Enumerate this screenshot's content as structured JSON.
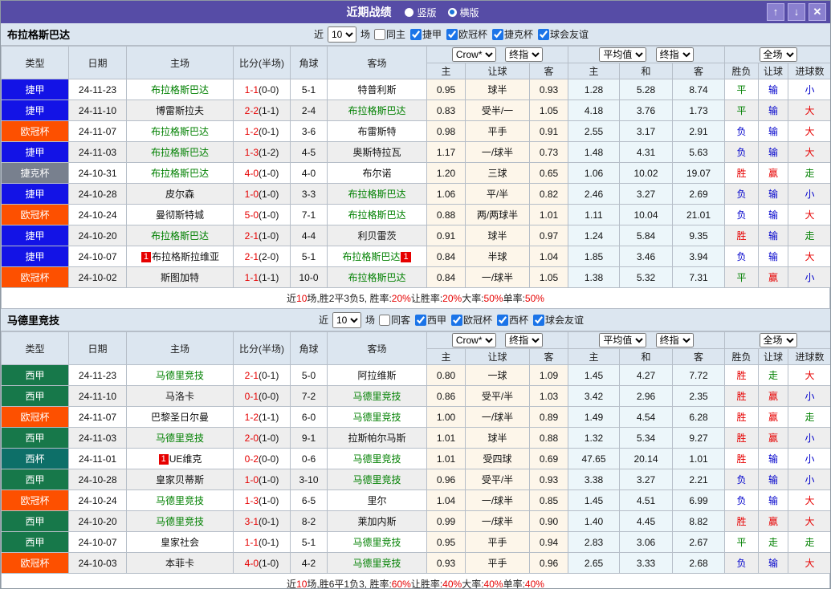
{
  "titlebar": {
    "title": "近期战绩",
    "radio_vertical": "竖版",
    "radio_horizontal": "横版"
  },
  "icons": {
    "up": "↑",
    "down": "↓",
    "close": "✕"
  },
  "headers": {
    "type": "类型",
    "date": "日期",
    "home": "主场",
    "score": "比分(半场)",
    "corner": "角球",
    "away": "客场",
    "sub_home": "主",
    "sub_handicap": "让球",
    "sub_away": "客",
    "sub_avg_home": "主",
    "sub_avg_draw": "和",
    "sub_avg_away": "客",
    "sub_wdl": "胜负",
    "sub_hcp": "让球",
    "sub_goals": "进球数"
  },
  "selects": {
    "source": "Crow*",
    "final": "终指",
    "average": "平均值",
    "fulltime": "全场"
  },
  "colors": {
    "league": {
      "捷甲": "#1313e6",
      "欧冠杯": "#fd5000",
      "捷克杯": "#78808e",
      "西甲": "#17784a",
      "西杯": "#0d6f68"
    },
    "result": {
      "胜": "#e60000",
      "平": "#008000",
      "负": "#0000cc",
      "赢": "#e60000",
      "输": "#0000cc",
      "走": "#008000",
      "大": "#e60000",
      "小": "#0000cc"
    },
    "accent_purple": "#564ca6",
    "team_green": "#008000",
    "score_red": "#e60000"
  },
  "sections": [
    {
      "team": "布拉格斯巴达",
      "filter": {
        "near": "近",
        "count": "10",
        "games": "场",
        "same": "同主",
        "same_checked": false,
        "leagues": [
          "捷甲",
          "欧冠杯",
          "捷克杯",
          "球会友谊"
        ],
        "leagues_checked": [
          true,
          true,
          true,
          true
        ]
      },
      "rows": [
        {
          "league": "捷甲",
          "date": "24-11-23",
          "home": {
            "name": "布拉格斯巴达",
            "self": true,
            "badge": null
          },
          "score": "1-1",
          "half": "(0-0)",
          "corners": "5-1",
          "away": {
            "name": "特普利斯",
            "self": false,
            "badge": null
          },
          "odds": [
            "0.95",
            "球半",
            "0.93"
          ],
          "avg": [
            "1.28",
            "5.28",
            "8.74"
          ],
          "results": [
            "平",
            "输",
            "小"
          ]
        },
        {
          "league": "捷甲",
          "date": "24-11-10",
          "home": {
            "name": "博雷斯拉夫",
            "self": false,
            "badge": null
          },
          "score": "2-2",
          "half": "(1-1)",
          "corners": "2-4",
          "away": {
            "name": "布拉格斯巴达",
            "self": true,
            "badge": null
          },
          "odds": [
            "0.83",
            "受半/一",
            "1.05"
          ],
          "avg": [
            "4.18",
            "3.76",
            "1.73"
          ],
          "results": [
            "平",
            "输",
            "大"
          ]
        },
        {
          "league": "欧冠杯",
          "date": "24-11-07",
          "home": {
            "name": "布拉格斯巴达",
            "self": true,
            "badge": null
          },
          "score": "1-2",
          "half": "(0-1)",
          "corners": "3-6",
          "away": {
            "name": "布雷斯特",
            "self": false,
            "badge": null
          },
          "odds": [
            "0.98",
            "平手",
            "0.91"
          ],
          "avg": [
            "2.55",
            "3.17",
            "2.91"
          ],
          "results": [
            "负",
            "输",
            "大"
          ]
        },
        {
          "league": "捷甲",
          "date": "24-11-03",
          "home": {
            "name": "布拉格斯巴达",
            "self": true,
            "badge": null
          },
          "score": "1-3",
          "half": "(1-2)",
          "corners": "4-5",
          "away": {
            "name": "奥斯特拉瓦",
            "self": false,
            "badge": null
          },
          "odds": [
            "1.17",
            "一/球半",
            "0.73"
          ],
          "avg": [
            "1.48",
            "4.31",
            "5.63"
          ],
          "results": [
            "负",
            "输",
            "大"
          ]
        },
        {
          "league": "捷克杯",
          "date": "24-10-31",
          "home": {
            "name": "布拉格斯巴达",
            "self": true,
            "badge": null
          },
          "score": "4-0",
          "half": "(1-0)",
          "corners": "4-0",
          "away": {
            "name": "布尔诺",
            "self": false,
            "badge": null
          },
          "odds": [
            "1.20",
            "三球",
            "0.65"
          ],
          "avg": [
            "1.06",
            "10.02",
            "19.07"
          ],
          "results": [
            "胜",
            "赢",
            "走"
          ]
        },
        {
          "league": "捷甲",
          "date": "24-10-28",
          "home": {
            "name": "皮尔森",
            "self": false,
            "badge": null
          },
          "score": "1-0",
          "half": "(1-0)",
          "corners": "3-3",
          "away": {
            "name": "布拉格斯巴达",
            "self": true,
            "badge": null
          },
          "odds": [
            "1.06",
            "平/半",
            "0.82"
          ],
          "avg": [
            "2.46",
            "3.27",
            "2.69"
          ],
          "results": [
            "负",
            "输",
            "小"
          ]
        },
        {
          "league": "欧冠杯",
          "date": "24-10-24",
          "home": {
            "name": "曼彻斯特城",
            "self": false,
            "badge": null
          },
          "score": "5-0",
          "half": "(1-0)",
          "corners": "7-1",
          "away": {
            "name": "布拉格斯巴达",
            "self": true,
            "badge": null
          },
          "odds": [
            "0.88",
            "两/两球半",
            "1.01"
          ],
          "avg": [
            "1.11",
            "10.04",
            "21.01"
          ],
          "results": [
            "负",
            "输",
            "大"
          ]
        },
        {
          "league": "捷甲",
          "date": "24-10-20",
          "home": {
            "name": "布拉格斯巴达",
            "self": true,
            "badge": null
          },
          "score": "2-1",
          "half": "(1-0)",
          "corners": "4-4",
          "away": {
            "name": "利贝雷茨",
            "self": false,
            "badge": null
          },
          "odds": [
            "0.91",
            "球半",
            "0.97"
          ],
          "avg": [
            "1.24",
            "5.84",
            "9.35"
          ],
          "results": [
            "胜",
            "输",
            "走"
          ]
        },
        {
          "league": "捷甲",
          "date": "24-10-07",
          "home": {
            "name": "布拉格斯拉维亚",
            "self": false,
            "badge": "before"
          },
          "score": "2-1",
          "half": "(2-0)",
          "corners": "5-1",
          "away": {
            "name": "布拉格斯巴达",
            "self": true,
            "badge": "after"
          },
          "odds": [
            "0.84",
            "半球",
            "1.04"
          ],
          "avg": [
            "1.85",
            "3.46",
            "3.94"
          ],
          "results": [
            "负",
            "输",
            "大"
          ]
        },
        {
          "league": "欧冠杯",
          "date": "24-10-02",
          "home": {
            "name": "斯图加特",
            "self": false,
            "badge": null
          },
          "score": "1-1",
          "half": "(1-1)",
          "corners": "10-0",
          "away": {
            "name": "布拉格斯巴达",
            "self": true,
            "badge": null
          },
          "odds": [
            "0.84",
            "一/球半",
            "1.05"
          ],
          "avg": [
            "1.38",
            "5.32",
            "7.31"
          ],
          "results": [
            "平",
            "赢",
            "小"
          ]
        }
      ],
      "summary": [
        {
          "t": "近",
          "red": false
        },
        {
          "t": "10",
          "red": true
        },
        {
          "t": "场,胜2平3负5, 胜率:",
          "red": false
        },
        {
          "t": "20%",
          "red": true
        },
        {
          "t": " 让胜率:",
          "red": false
        },
        {
          "t": "20%",
          "red": true
        },
        {
          "t": " 大率:",
          "red": false
        },
        {
          "t": "50%",
          "red": true
        },
        {
          "t": " 单率:",
          "red": false
        },
        {
          "t": "50%",
          "red": true
        }
      ]
    },
    {
      "team": "马德里竞技",
      "filter": {
        "near": "近",
        "count": "10",
        "games": "场",
        "same": "同客",
        "same_checked": false,
        "leagues": [
          "西甲",
          "欧冠杯",
          "西杯",
          "球会友谊"
        ],
        "leagues_checked": [
          true,
          true,
          true,
          true
        ]
      },
      "rows": [
        {
          "league": "西甲",
          "date": "24-11-23",
          "home": {
            "name": "马德里竞技",
            "self": true,
            "badge": null
          },
          "score": "2-1",
          "half": "(0-1)",
          "corners": "5-0",
          "away": {
            "name": "阿拉维斯",
            "self": false,
            "badge": null
          },
          "odds": [
            "0.80",
            "一球",
            "1.09"
          ],
          "avg": [
            "1.45",
            "4.27",
            "7.72"
          ],
          "results": [
            "胜",
            "走",
            "大"
          ]
        },
        {
          "league": "西甲",
          "date": "24-11-10",
          "home": {
            "name": "马洛卡",
            "self": false,
            "badge": null
          },
          "score": "0-1",
          "half": "(0-0)",
          "corners": "7-2",
          "away": {
            "name": "马德里竞技",
            "self": true,
            "badge": null
          },
          "odds": [
            "0.86",
            "受平/半",
            "1.03"
          ],
          "avg": [
            "3.42",
            "2.96",
            "2.35"
          ],
          "results": [
            "胜",
            "赢",
            "小"
          ]
        },
        {
          "league": "欧冠杯",
          "date": "24-11-07",
          "home": {
            "name": "巴黎圣日尔曼",
            "self": false,
            "badge": null
          },
          "score": "1-2",
          "half": "(1-1)",
          "corners": "6-0",
          "away": {
            "name": "马德里竞技",
            "self": true,
            "badge": null
          },
          "odds": [
            "1.00",
            "一/球半",
            "0.89"
          ],
          "avg": [
            "1.49",
            "4.54",
            "6.28"
          ],
          "results": [
            "胜",
            "赢",
            "走"
          ]
        },
        {
          "league": "西甲",
          "date": "24-11-03",
          "home": {
            "name": "马德里竞技",
            "self": true,
            "badge": null
          },
          "score": "2-0",
          "half": "(1-0)",
          "corners": "9-1",
          "away": {
            "name": "拉斯帕尔马斯",
            "self": false,
            "badge": null
          },
          "odds": [
            "1.01",
            "球半",
            "0.88"
          ],
          "avg": [
            "1.32",
            "5.34",
            "9.27"
          ],
          "results": [
            "胜",
            "赢",
            "小"
          ]
        },
        {
          "league": "西杯",
          "date": "24-11-01",
          "home": {
            "name": "UE维克",
            "self": false,
            "badge": "before"
          },
          "score": "0-2",
          "half": "(0-0)",
          "corners": "0-6",
          "away": {
            "name": "马德里竞技",
            "self": true,
            "badge": null
          },
          "odds": [
            "1.01",
            "受四球",
            "0.69"
          ],
          "avg": [
            "47.65",
            "20.14",
            "1.01"
          ],
          "results": [
            "胜",
            "输",
            "小"
          ]
        },
        {
          "league": "西甲",
          "date": "24-10-28",
          "home": {
            "name": "皇家贝蒂斯",
            "self": false,
            "badge": null
          },
          "score": "1-0",
          "half": "(1-0)",
          "corners": "3-10",
          "away": {
            "name": "马德里竞技",
            "self": true,
            "badge": null
          },
          "odds": [
            "0.96",
            "受平/半",
            "0.93"
          ],
          "avg": [
            "3.38",
            "3.27",
            "2.21"
          ],
          "results": [
            "负",
            "输",
            "小"
          ]
        },
        {
          "league": "欧冠杯",
          "date": "24-10-24",
          "home": {
            "name": "马德里竞技",
            "self": true,
            "badge": null
          },
          "score": "1-3",
          "half": "(1-0)",
          "corners": "6-5",
          "away": {
            "name": "里尔",
            "self": false,
            "badge": null
          },
          "odds": [
            "1.04",
            "一/球半",
            "0.85"
          ],
          "avg": [
            "1.45",
            "4.51",
            "6.99"
          ],
          "results": [
            "负",
            "输",
            "大"
          ]
        },
        {
          "league": "西甲",
          "date": "24-10-20",
          "home": {
            "name": "马德里竞技",
            "self": true,
            "badge": null
          },
          "score": "3-1",
          "half": "(0-1)",
          "corners": "8-2",
          "away": {
            "name": "莱加内斯",
            "self": false,
            "badge": null
          },
          "odds": [
            "0.99",
            "一/球半",
            "0.90"
          ],
          "avg": [
            "1.40",
            "4.45",
            "8.82"
          ],
          "results": [
            "胜",
            "赢",
            "大"
          ]
        },
        {
          "league": "西甲",
          "date": "24-10-07",
          "home": {
            "name": "皇家社会",
            "self": false,
            "badge": null
          },
          "score": "1-1",
          "half": "(0-1)",
          "corners": "5-1",
          "away": {
            "name": "马德里竞技",
            "self": true,
            "badge": null
          },
          "odds": [
            "0.95",
            "平手",
            "0.94"
          ],
          "avg": [
            "2.83",
            "3.06",
            "2.67"
          ],
          "results": [
            "平",
            "走",
            "走"
          ]
        },
        {
          "league": "欧冠杯",
          "date": "24-10-03",
          "home": {
            "name": "本菲卡",
            "self": false,
            "badge": null
          },
          "score": "4-0",
          "half": "(1-0)",
          "corners": "4-2",
          "away": {
            "name": "马德里竞技",
            "self": true,
            "badge": null
          },
          "odds": [
            "0.93",
            "平手",
            "0.96"
          ],
          "avg": [
            "2.65",
            "3.33",
            "2.68"
          ],
          "results": [
            "负",
            "输",
            "大"
          ]
        }
      ],
      "summary": [
        {
          "t": "近",
          "red": false
        },
        {
          "t": "10",
          "red": true
        },
        {
          "t": "场,胜6平1负3, 胜率:",
          "red": false
        },
        {
          "t": "60%",
          "red": true
        },
        {
          "t": " 让胜率:",
          "red": false
        },
        {
          "t": "40%",
          "red": true
        },
        {
          "t": " 大率:",
          "red": false
        },
        {
          "t": "40%",
          "red": true
        },
        {
          "t": " 单率:",
          "red": false
        },
        {
          "t": "40%",
          "red": true
        }
      ]
    }
  ]
}
